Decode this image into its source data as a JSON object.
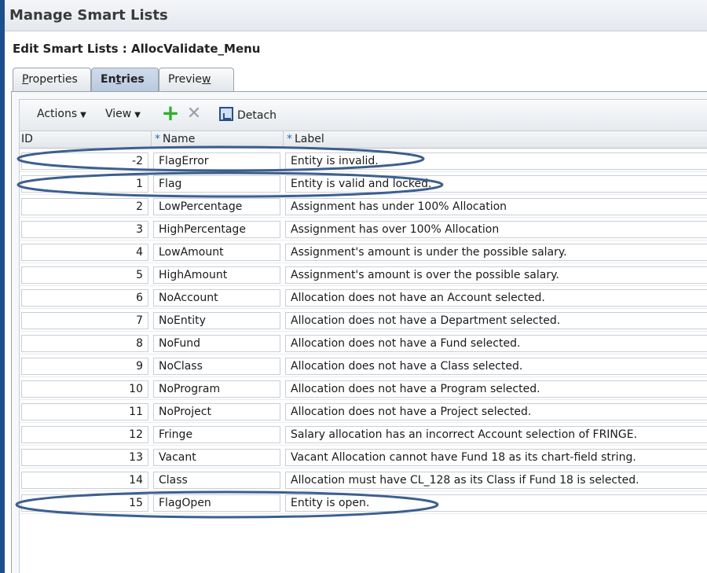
{
  "window": {
    "title": "Manage Smart Lists"
  },
  "page": {
    "subtitle": "Edit Smart Lists : AllocValidate_Menu"
  },
  "tabs": [
    {
      "label_pre": "",
      "label_u": "P",
      "label_post": "roperties",
      "active": false
    },
    {
      "label_pre": "En",
      "label_u": "t",
      "label_post": "ries",
      "active": true
    },
    {
      "label_pre": "Previe",
      "label_u": "w",
      "label_post": "",
      "active": false
    }
  ],
  "toolbar": {
    "actions_label": "Actions",
    "view_label": "View",
    "add_icon": "add-plus-icon",
    "delete_icon": "delete-x-icon",
    "detach_label": "Detach"
  },
  "table": {
    "columns": {
      "id": "ID",
      "name": "Name",
      "label": "Label",
      "required_marker": "*"
    },
    "rows": [
      {
        "id": "-2",
        "name": "FlagError",
        "label": "Entity is invalid."
      },
      {
        "id": "1",
        "name": "Flag",
        "label": "Entity is valid and locked."
      },
      {
        "id": "2",
        "name": "LowPercentage",
        "label": "Assignment has under 100% Allocation"
      },
      {
        "id": "3",
        "name": "HighPercentage",
        "label": "Assignment has over 100% Allocation"
      },
      {
        "id": "4",
        "name": "LowAmount",
        "label": "Assignment's amount is under the possible salary."
      },
      {
        "id": "5",
        "name": "HighAmount",
        "label": "Assignment's amount is over the possible salary."
      },
      {
        "id": "6",
        "name": "NoAccount",
        "label": "Allocation does not have an Account  selected."
      },
      {
        "id": "7",
        "name": "NoEntity",
        "label": "Allocation does not have a Department selected."
      },
      {
        "id": "8",
        "name": "NoFund",
        "label": "Allocation does not have a Fund selected."
      },
      {
        "id": "9",
        "name": "NoClass",
        "label": "Allocation does not have a Class selected."
      },
      {
        "id": "10",
        "name": "NoProgram",
        "label": "Allocation does not have a Program selected."
      },
      {
        "id": "11",
        "name": "NoProject",
        "label": "Allocation does not have a Project selected."
      },
      {
        "id": "12",
        "name": "Fringe",
        "label": "Salary allocation has an incorrect Account selection of FRINGE."
      },
      {
        "id": "13",
        "name": "Vacant",
        "label": "Vacant Allocation cannot have Fund 18 as its chart-field string."
      },
      {
        "id": "14",
        "name": "Class",
        "label": "Allocation must have CL_128 as its Class if Fund 18 is selected."
      },
      {
        "id": "15",
        "name": "FlagOpen",
        "label": "Entity is open."
      }
    ]
  },
  "colors": {
    "annotation": "#3d5f8f",
    "accent": "#2a6fb7"
  }
}
